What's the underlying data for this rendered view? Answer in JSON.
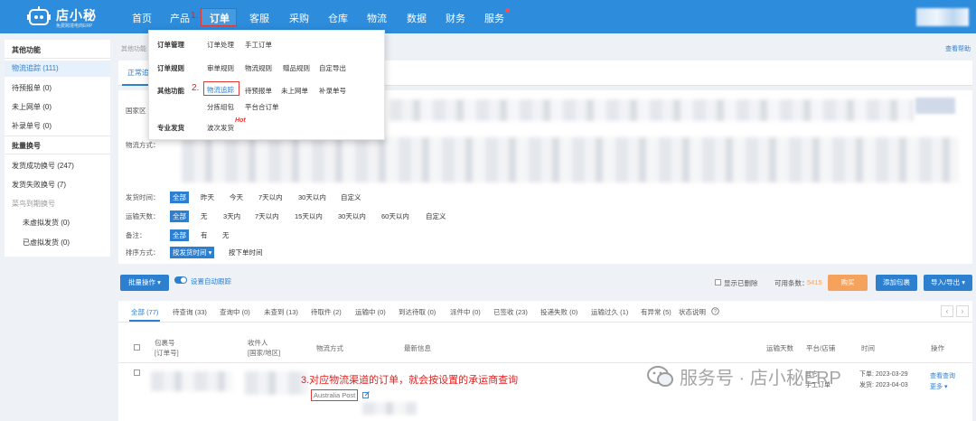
{
  "brand": {
    "name": "店小秘",
    "slogan": "免费跨境电商ERP"
  },
  "nav": {
    "items": [
      "首页",
      "产品",
      "订单",
      "客服",
      "采购",
      "仓库",
      "物流",
      "数据",
      "财务",
      "服务"
    ],
    "active_index": 2
  },
  "annotations": {
    "step1": "1.",
    "step2": "2.",
    "step3": "3.对应物流渠道的订单，就会按设置的承运商查询"
  },
  "dropdown": {
    "groups": [
      {
        "title": "订单管理",
        "items": [
          "订单处理",
          "手工订单"
        ]
      },
      {
        "title": "订单规则",
        "items": [
          "审单规则",
          "物流规则",
          "赠品规则",
          "自定导出"
        ]
      },
      {
        "title": "其他功能",
        "items": [
          "物流追踪",
          "待预报单",
          "未上网单",
          "补录单号",
          "分拣组包",
          "平台合订单"
        ]
      },
      {
        "title": "专业发货",
        "items": [
          "波次发货"
        ]
      }
    ],
    "hot_badge": "Hot"
  },
  "sidebar": {
    "section1": "其他功能",
    "items1": [
      "物流追踪 (111)",
      "待预报单 (0)",
      "未上网单 (0)",
      "补录单号 (0)"
    ],
    "section2": "批量换号",
    "items2": [
      "发货成功换号 (247)",
      "发货失败换号 (7)",
      "菜鸟到期换号",
      "未虚拟发货 (0)",
      "已虚拟发货 (0)"
    ]
  },
  "breadcrumb": "其他功能",
  "help_link": "查看帮助",
  "main_tab": "正常追",
  "filters": {
    "country_label": "国家区",
    "method_label": "物流方式：",
    "ship_time": {
      "label": "发货时间：",
      "options": [
        "全部",
        "昨天",
        "今天",
        "7天以内",
        "30天以内",
        "自定义"
      ],
      "selected": 0
    },
    "transit_days": {
      "label": "运输天数：",
      "options": [
        "全部",
        "无",
        "3天内",
        "7天以内",
        "15天以内",
        "30天以内",
        "60天以内",
        "自定义"
      ],
      "selected": 0
    },
    "note": {
      "label": "备注：",
      "options": [
        "全部",
        "有",
        "无"
      ],
      "selected": 0
    },
    "sort": {
      "label": "排序方式：",
      "options": [
        "按发货时间 ▾",
        "按下单时间"
      ],
      "selected": 0
    }
  },
  "toolbar": {
    "batch_button": "批量操作 ▾",
    "auto_track_label": "设置自动跟踪",
    "show_deleted": "显示已删除",
    "available_label": "可用条数：",
    "available_count": "5415",
    "buy_button": "购买",
    "add_package_button": "添加包裹",
    "import_export_button": "导入/导出 ▾"
  },
  "status_tabs": [
    {
      "label": "全部 (77)",
      "count_color": "#2d7fd0"
    },
    {
      "label": "待查询 (33)",
      "count_color": "#e6a23c"
    },
    {
      "label": "查询中 (0)"
    },
    {
      "label": "未查到 (13)"
    },
    {
      "label": "待取件 (2)"
    },
    {
      "label": "运输中 (0)"
    },
    {
      "label": "到达待取 (0)"
    },
    {
      "label": "派件中 (0)"
    },
    {
      "label": "已签收 (23)"
    },
    {
      "label": "投递失败 (0)"
    },
    {
      "label": "运输过久 (1)"
    },
    {
      "label": "有异常 (5)"
    },
    {
      "label": "状态说明"
    }
  ],
  "table": {
    "columns": [
      "包裹号\n[订单号]",
      "收件人\n[国家/地区]",
      "物流方式",
      "最新信息",
      "运输天数",
      "平台/店铺",
      "时间",
      "操作"
    ],
    "row": {
      "carrier": "Australia Post",
      "platform": "其它",
      "platform2": "手工订单",
      "time1": "下单: 2023-03-29",
      "time2": "发货: 2023-04-03",
      "op1": "查看查询",
      "op2": "更多 ▾"
    }
  },
  "watermark": "服务号 · 店小秘ERP",
  "colors": {
    "primary": "#2d8cdc",
    "accent_red": "#e53935",
    "orange": "#f5a25d"
  }
}
